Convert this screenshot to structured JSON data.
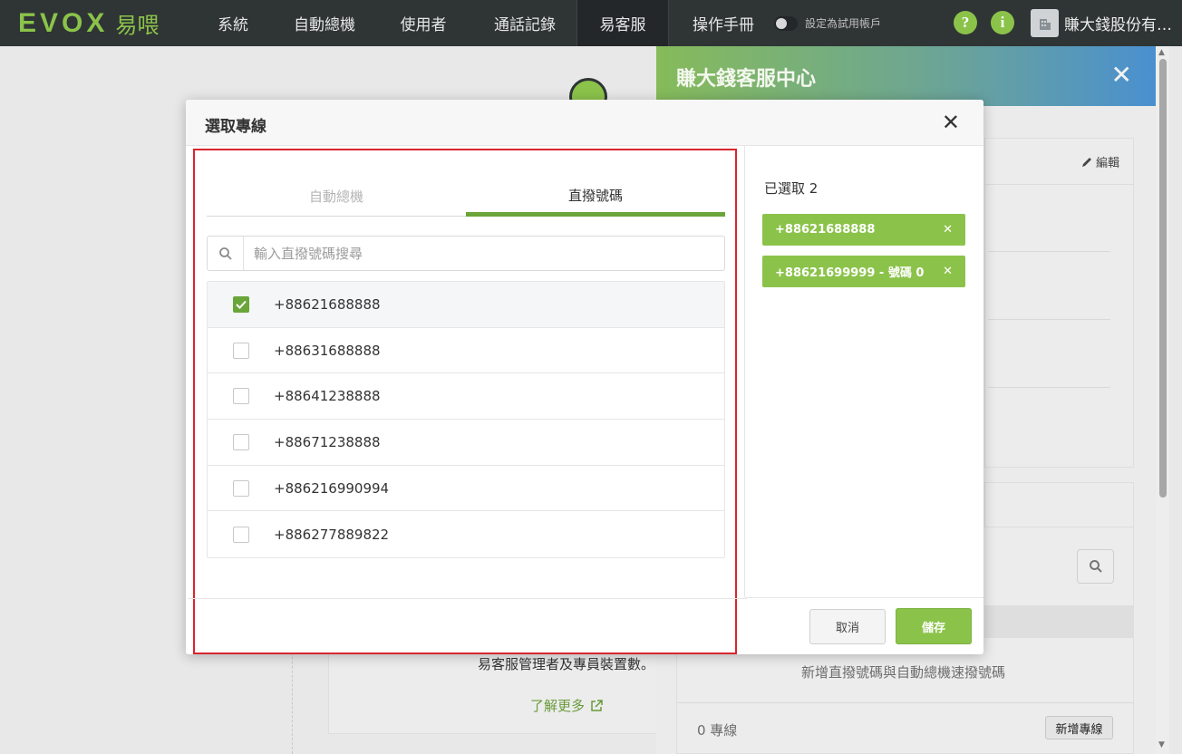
{
  "nav": {
    "logo_text": "EVOX",
    "logo_cn": "易喂",
    "items": [
      {
        "label": "系統"
      },
      {
        "label": "自動總機"
      },
      {
        "label": "使用者"
      },
      {
        "label": "通話記錄"
      },
      {
        "label": "易客服",
        "active": true
      },
      {
        "label": "操作手冊"
      }
    ],
    "trial_label": "設定為試用帳戶",
    "help_icon": "?",
    "info_icon": "i",
    "company_name": "賺大錢股份有限公司"
  },
  "background": {
    "description_text": "易客服管理者及專員裝置數。",
    "learn_more": "了解更多",
    "side_panel": {
      "title": "賺大錢客服中心",
      "edit_label": "編輯",
      "add_hint": "新增直撥號碼與自動總機速撥號碼",
      "line_count": "0 專線",
      "add_line_button": "新增專線"
    }
  },
  "modal": {
    "title": "選取專線",
    "tabs": [
      {
        "label": "自動總機",
        "active": false
      },
      {
        "label": "直撥號碼",
        "active": true
      }
    ],
    "search": {
      "placeholder": "輸入直撥號碼搜尋",
      "value": ""
    },
    "numbers": [
      {
        "label": "+88621688888",
        "checked": true
      },
      {
        "label": "+88631688888",
        "checked": false
      },
      {
        "label": "+88641238888",
        "checked": false
      },
      {
        "label": "+88671238888",
        "checked": false
      },
      {
        "label": "+886216990994",
        "checked": false
      },
      {
        "label": "+886277889822",
        "checked": false
      }
    ],
    "selected_label": "已選取 2",
    "selected_chips": [
      {
        "label": "+88621688888"
      },
      {
        "label": "+88621699999 - 號碼 0"
      }
    ],
    "cancel_label": "取消",
    "save_label": "儲存"
  },
  "colors": {
    "brand_green": "#8bc34a",
    "tab_active": "#6aa53a",
    "nav_bg": "#2f3435",
    "highlight_border": "#d9262e"
  }
}
